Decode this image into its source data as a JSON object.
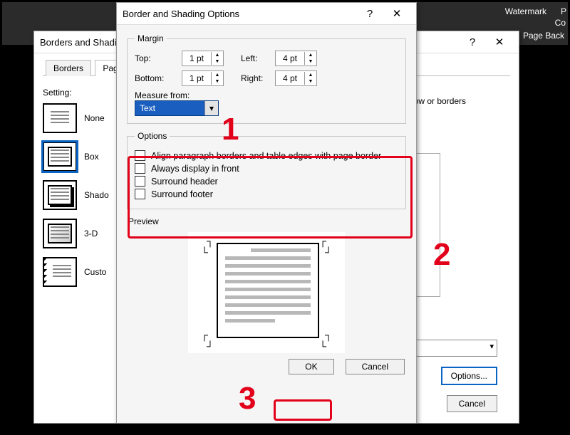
{
  "ribbon": {
    "item1": "Watermark",
    "item2": "P",
    "item3": "Co",
    "item4": "Page Back"
  },
  "back_dialog": {
    "title": "Borders and Shading",
    "help": "?",
    "close": "✕",
    "tabs": {
      "borders": "Borders",
      "page": "Pag"
    },
    "setting_hdr": "Setting:",
    "settings": {
      "none": "None",
      "box": "Box",
      "shadow": "Shado",
      "threeD": "3-D",
      "custom": "Custo"
    },
    "preview_hint": "low or borders",
    "options_btn": "Options...",
    "cancel_btn": "Cancel"
  },
  "front_dialog": {
    "title": "Border and Shading Options",
    "help": "?",
    "close": "✕",
    "margin": {
      "legend": "Margin",
      "top_label": "Top:",
      "bottom_label": "Bottom:",
      "left_label": "Left:",
      "right_label": "Right:",
      "top_val": "1 pt",
      "bottom_val": "1 pt",
      "left_val": "4 pt",
      "right_val": "4 pt"
    },
    "measure": {
      "label": "Measure from:",
      "value": "Text"
    },
    "options": {
      "legend": "Options",
      "align": "Align paragraph borders and table edges with page border",
      "front": "Always display in front",
      "header": "Surround header",
      "footer": "Surround footer"
    },
    "preview_legend": "Preview",
    "ok": "OK",
    "cancel": "Cancel"
  },
  "annotations": {
    "n1": "1",
    "n2": "2",
    "n3": "3"
  }
}
